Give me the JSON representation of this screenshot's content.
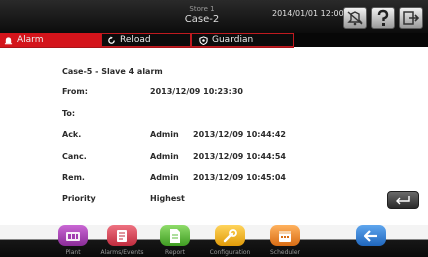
{
  "header": {
    "store": "Store 1",
    "case": "Case-2",
    "datetime": "2014/01/01  12:00"
  },
  "tabs": {
    "alarm": "Alarm",
    "reload": "Reload",
    "guardian": "Guardian"
  },
  "alarm_detail": {
    "title": "Case-5 - Slave 4 alarm",
    "from_label": "From:",
    "from_value": "2013/12/09 10:23:30",
    "to_label": "To:",
    "to_value": "",
    "ack_label": "Ack.",
    "ack_user": "Admin",
    "ack_time": "2013/12/09 10:44:42",
    "canc_label": "Canc.",
    "canc_user": "Admin",
    "canc_time": "2013/12/09 10:44:54",
    "rem_label": "Rem.",
    "rem_user": "Admin",
    "rem_time": "2013/12/09 10:45:04",
    "priority_label": "Priority",
    "priority_value": "Highest"
  },
  "nav": {
    "plant": "Plant",
    "alarms_events": "Alarms/Events",
    "report": "Report",
    "configuration": "Configuration",
    "scheduler": "Scheduler"
  },
  "colors": {
    "alarm_red": "#d4141b",
    "plant_purple": "#a23cb0",
    "alarms_red": "#d23a4c",
    "report_green": "#5cbd3c",
    "config_yellow": "#f0b21c",
    "scheduler_orange": "#f08a2e",
    "back_blue": "#2b79d4"
  },
  "icons": {
    "settings": "alarm-settings-icon",
    "help": "help-icon",
    "logout": "logout-icon",
    "reload": "reload-icon",
    "guardian": "guardian-icon",
    "alarm": "bell-icon",
    "enter": "enter-arrow-icon",
    "back": "back-arrow-icon"
  }
}
